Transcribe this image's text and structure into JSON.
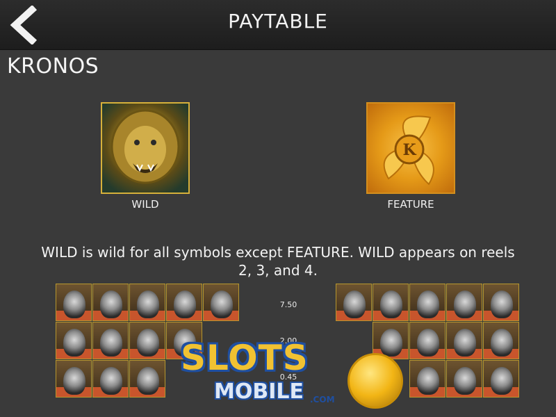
{
  "header": {
    "title": "PAYTABLE",
    "back_icon": "chevron-left-icon"
  },
  "game_name": "KRONOS",
  "symbols": [
    {
      "label": "WILD",
      "icon": "lion-head-icon"
    },
    {
      "label": "FEATURE",
      "icon": "winged-k-coin-icon"
    }
  ],
  "description": "WILD is wild for all symbols except FEATURE. WILD appears on reels 2, 3, and 4.",
  "payouts": [
    "7.50",
    "2.00",
    "0.45"
  ],
  "watermark": {
    "line1": "SLOTS",
    "line2": "MOBILE",
    "suffix": ".COM"
  },
  "grids": {
    "left_rows": [
      5,
      4,
      3
    ],
    "right_rows": [
      5,
      4,
      3
    ],
    "cell_icon": "kronos-symbol-icon"
  }
}
